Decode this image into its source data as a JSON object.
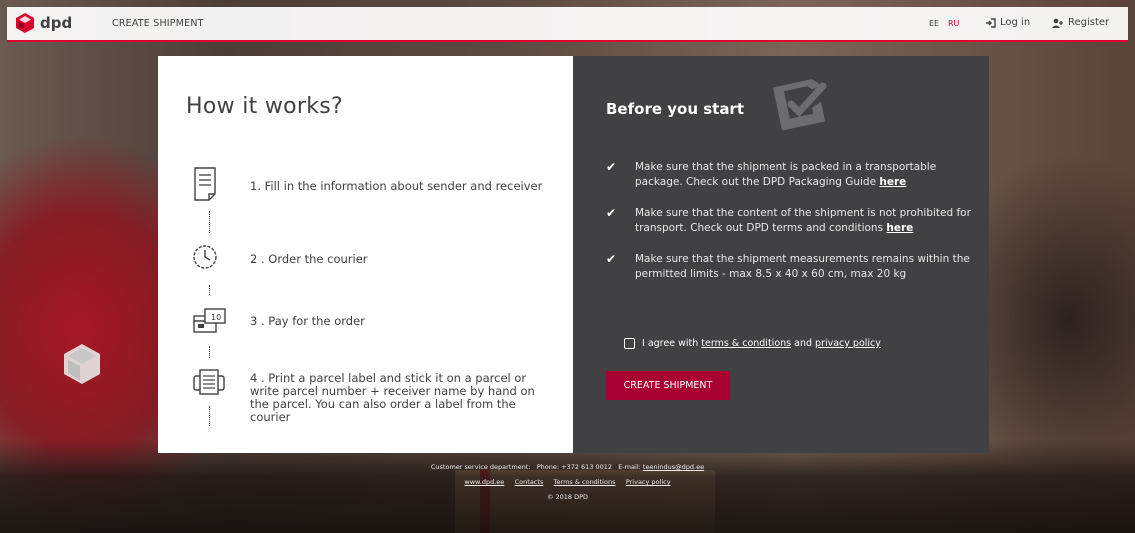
{
  "header": {
    "logo_text": "dpd",
    "nav_create": "CREATE SHIPMENT",
    "lang_ee": "EE",
    "lang_ru": "RU",
    "login": "Log in",
    "register": "Register",
    "accent_color": "#dc0032"
  },
  "how": {
    "title": "How it works?",
    "steps": [
      {
        "icon": "document-icon",
        "text": "1. Fill in the information about sender and receiver"
      },
      {
        "icon": "clock-icon",
        "text": "2 . Order the courier"
      },
      {
        "icon": "payment-card-icon",
        "text": "3 . Pay for the order"
      },
      {
        "icon": "printer-icon",
        "text": "4 . Print a parcel label and stick it on a parcel or write parcel number + receiver name by hand on the parcel. You can also order a label from the courier"
      }
    ]
  },
  "before": {
    "title": "Before you start",
    "requirements": [
      {
        "text": "Make sure that the shipment is packed in a transportable package. Check out the DPD Packaging Guide ",
        "link": "here"
      },
      {
        "text": "Make sure that the content of the shipment is not prohibited for transport. Check out DPD terms and conditions ",
        "link": "here"
      },
      {
        "text": "Make sure that the shipment measurements remains within the permitted limits - max 8.5 x 40 x 60 cm, max 20 kg",
        "link": ""
      }
    ],
    "agree_prefix": "I agree with ",
    "agree_terms": "terms & conditions",
    "agree_and": " and ",
    "agree_privacy": "privacy policy",
    "button": "CREATE SHIPMENT",
    "button_color": "#a90034"
  },
  "footer": {
    "dept": "Customer service department:",
    "phone": "Phone: +372 613 0012",
    "email_label": "E-mail:",
    "email": "teenindus@dpd.ee",
    "links": [
      "www.dpd.ee",
      "Contacts",
      "Terms & conditions",
      "Privacy policy"
    ],
    "copyright": "© 2018 DPD"
  }
}
